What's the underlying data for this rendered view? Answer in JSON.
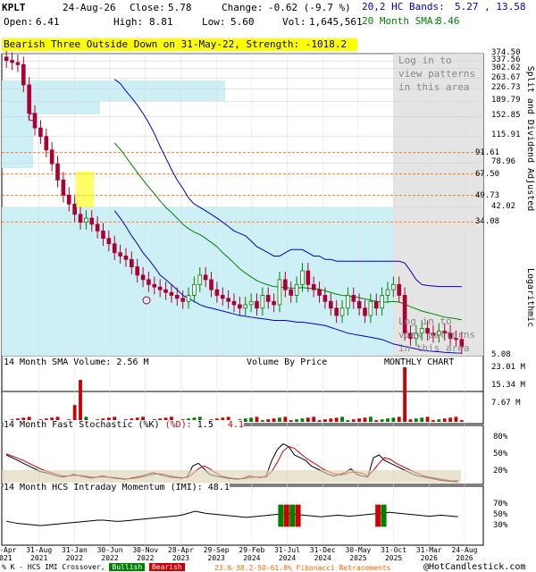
{
  "header": {
    "ticker": "KPLT",
    "date": "24-Aug-26",
    "close_label": "Close:",
    "close": "5.78",
    "change_label": "Change:",
    "change": "-0.62 (-9.7 %)",
    "open_label": "Open:",
    "open": "6.41",
    "high_label": "High:",
    "high": "8.81",
    "low_label": "Low:",
    "low": "5.60",
    "vol_label": "Vol:",
    "vol": "1,645,561",
    "bands_label": "20,2 HC Bands:",
    "bands_value": "5.27 , 13.58",
    "sma_label": "20 Month SMA:",
    "sma_value": "8.46"
  },
  "signal_banner": "Bearish Three Outside Down on 31-May-22, Strength: -1018.2",
  "login_text": "Log in to view patterns in this area",
  "right_axis_label": "Split and Dividend Adjusted",
  "log_label": "Logarithmic",
  "volume_panel_label": "14 Month SMA Volume: 2.56 M",
  "vbp_label": "Volume By Price",
  "monthly_label": "MONTHLY CHART",
  "stoch_panel_label": "14 Month Fast Stochastic (%K)",
  "stoch_d_label": "(%D):",
  "stoch_k_value": "1.5",
  "stoch_d_value": "4.1",
  "imi_panel_label": "14 Month HCS Intraday Momentum (IMI): 48.1",
  "footer": {
    "prefix": "% K - HCS IMI Crossover,",
    "bullish": "Bullish",
    "bearish": "Bearish",
    "fib": "23.6-38.2-50-61.8% Fibonacci Retracements",
    "copyright": "@HotCandlestick.com"
  },
  "colors": {
    "up": "#008000",
    "down": "#aa0033",
    "vbp": "#cdf0f7",
    "sma20": "#008000",
    "bands": "#0000cc",
    "fib": "#ff6600"
  },
  "chart_data": [
    {
      "type": "candlestick",
      "title": "KPLT monthly",
      "scale": "log",
      "ylim": [
        5.08,
        374.5
      ],
      "y_ticks": [
        "374.50",
        "337.56",
        "302.62",
        "263.67",
        "226.73",
        "189.79",
        "152.85",
        "115.91",
        "78.96",
        "42.02",
        "5.08"
      ],
      "fib_levels": [
        91.61,
        67.5,
        49.73,
        34.08
      ],
      "x_ticks": [
        "30-Apr 2021",
        "31-Aug 2021",
        "31-Jan 2022",
        "30-Jun 2022",
        "30-Nov 2022",
        "28-Apr 2023",
        "29-Sep 2023",
        "29-Feb 2024",
        "31-Jul 2024",
        "31-Dec 2024",
        "30-May 2025",
        "31-Oct 2025",
        "31-Mar 2026",
        "24-Aug 2026"
      ],
      "close": [
        340,
        330,
        320,
        240,
        160,
        130,
        115,
        95,
        78,
        62,
        50,
        44,
        38,
        34,
        36,
        33,
        30,
        27,
        25,
        22,
        21,
        20,
        18,
        16,
        15,
        14,
        13.5,
        13,
        12.5,
        12,
        11.5,
        11,
        12,
        14,
        16,
        15,
        13,
        12,
        11.5,
        11,
        10.5,
        10,
        10.5,
        11,
        10,
        12,
        11,
        10.5,
        15,
        13,
        12,
        14,
        17,
        14,
        13,
        12,
        11,
        10,
        9,
        10,
        12,
        11,
        10,
        9,
        11,
        10,
        12,
        13,
        14,
        12,
        7,
        6.5,
        7,
        7.5,
        7,
        6.8,
        7.2,
        7,
        6.5,
        6.4,
        5.78
      ],
      "sma20": [
        null,
        null,
        null,
        null,
        null,
        null,
        null,
        null,
        null,
        null,
        null,
        null,
        null,
        null,
        null,
        null,
        null,
        null,
        null,
        105,
        96,
        86,
        77,
        69,
        62,
        56,
        51,
        46,
        42,
        39,
        36,
        33,
        31,
        29.5,
        28.5,
        27,
        25.5,
        24,
        22,
        20.5,
        19,
        17.5,
        16.5,
        15.6,
        14.8,
        14.3,
        13.9,
        13.6,
        13.5,
        13.4,
        13.3,
        13.3,
        13.4,
        13.3,
        13.2,
        13.1,
        12.8,
        12.5,
        12.2,
        12,
        11.9,
        11.8,
        11.6,
        11.4,
        11.2,
        11.0,
        10.9,
        10.9,
        11.0,
        10.9,
        10.6,
        10.2,
        9.9,
        9.6,
        9.4,
        9.2,
        9.0,
        8.8,
        8.7,
        8.6,
        8.46
      ],
      "band_upper": [
        null,
        null,
        null,
        null,
        null,
        null,
        null,
        null,
        null,
        null,
        null,
        null,
        null,
        null,
        null,
        null,
        null,
        null,
        null,
        260,
        245,
        220,
        200,
        180,
        160,
        140,
        120,
        100,
        85,
        72,
        62,
        55,
        48,
        44,
        42,
        40,
        38,
        36,
        34,
        32,
        30,
        29,
        28,
        26,
        24,
        23,
        22,
        21,
        21,
        22,
        23,
        23,
        23,
        22,
        21,
        21,
        20,
        20,
        19.5,
        19.5,
        19.5,
        19.5,
        19.5,
        19.5,
        19.5,
        19.5,
        19.5,
        19.5,
        19.5,
        19.5,
        19,
        17,
        15,
        14,
        13.8,
        13.7,
        13.6,
        13.6,
        13.6,
        13.6,
        13.58
      ],
      "band_lower": [
        null,
        null,
        null,
        null,
        null,
        null,
        null,
        null,
        null,
        null,
        null,
        null,
        null,
        null,
        null,
        null,
        null,
        null,
        null,
        40,
        36,
        32,
        28,
        25,
        22,
        20,
        18,
        16,
        15,
        14,
        13,
        12,
        11.5,
        11,
        10.5,
        10.2,
        10,
        9.8,
        9.6,
        9.4,
        9.2,
        9,
        8.9,
        8.8,
        8.7,
        8.6,
        8.5,
        8.4,
        8.4,
        8.4,
        8.3,
        8.2,
        8.2,
        8.1,
        8.0,
        7.9,
        7.8,
        7.6,
        7.4,
        7.2,
        7.0,
        6.9,
        6.8,
        6.7,
        6.6,
        6.5,
        6.4,
        6.2,
        6.0,
        5.9,
        5.8,
        5.7,
        5.6,
        5.5,
        5.45,
        5.4,
        5.37,
        5.33,
        5.3,
        5.28,
        5.27
      ]
    },
    {
      "type": "bar",
      "title": "14 Month SMA Volume",
      "y_ticks": [
        "23.01 M",
        "15.34 M",
        "7.67 M"
      ],
      "ylim": [
        0,
        23.01
      ]
    },
    {
      "type": "line",
      "title": "14 Month Fast Stochastic",
      "y_ticks": [
        "80%",
        "50%",
        "20%"
      ],
      "ylim": [
        0,
        100
      ],
      "k": [
        50,
        45,
        40,
        35,
        30,
        25,
        20,
        18,
        15,
        12,
        10,
        12,
        15,
        12,
        10,
        8,
        10,
        12,
        10,
        8,
        7,
        6,
        8,
        10,
        12,
        15,
        18,
        15,
        12,
        10,
        9,
        8,
        10,
        30,
        35,
        25,
        15,
        12,
        10,
        8,
        7,
        6,
        8,
        12,
        10,
        9,
        12,
        40,
        60,
        70,
        65,
        50,
        45,
        40,
        30,
        25,
        20,
        15,
        12,
        15,
        18,
        25,
        15,
        12,
        10,
        45,
        50,
        40,
        35,
        30,
        25,
        20,
        15,
        12,
        10,
        8,
        6,
        4,
        3,
        2,
        1.5
      ],
      "d": [
        52,
        48,
        44,
        40,
        35,
        30,
        25,
        21,
        18,
        15,
        12,
        12,
        13,
        13,
        12,
        10,
        10,
        10,
        10,
        9,
        8,
        7,
        7,
        8,
        10,
        12,
        15,
        16,
        15,
        12,
        10,
        9,
        9,
        16,
        25,
        30,
        25,
        18,
        12,
        10,
        8,
        7,
        7,
        9,
        10,
        10,
        10,
        20,
        37,
        57,
        65,
        62,
        53,
        45,
        38,
        32,
        25,
        20,
        16,
        14,
        15,
        19,
        19,
        17,
        12,
        22,
        35,
        45,
        42,
        35,
        30,
        25,
        20,
        16,
        12,
        10,
        8,
        6,
        4.5,
        3,
        4.1
      ]
    },
    {
      "type": "line",
      "title": "14 Month HCS Intraday Momentum (IMI)",
      "y_ticks": [
        "70%",
        "50%",
        "30%"
      ],
      "ylim": [
        0,
        100
      ],
      "imi": [
        40,
        38,
        36,
        35,
        34,
        33,
        32,
        33,
        34,
        35,
        36,
        37,
        38,
        39,
        40,
        41,
        42,
        42,
        41,
        40,
        40,
        41,
        42,
        43,
        44,
        45,
        46,
        47,
        48,
        49,
        50,
        52,
        55,
        58,
        56,
        54,
        53,
        52,
        51,
        50,
        49,
        48,
        47,
        48,
        49,
        50,
        51,
        52,
        53,
        54,
        53,
        52,
        51,
        50,
        49,
        48,
        49,
        50,
        51,
        50,
        49,
        50,
        51,
        52,
        53,
        54,
        55,
        56,
        55,
        54,
        53,
        52,
        51,
        50,
        49,
        50,
        51,
        50,
        49,
        48.1
      ]
    }
  ]
}
